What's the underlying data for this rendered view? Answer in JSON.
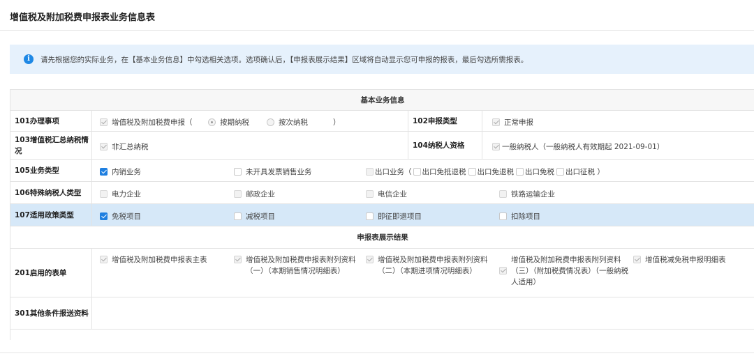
{
  "page_title": "增值税及附加税费申报表业务信息表",
  "notice": "请先根据您的实际业务，在【基本业务信息】中勾选相关选项。选项确认后，【申报表展示结果】区域将自动显示您可申报的报表，最后勾选所需报表。",
  "sections": {
    "basic": "基本业务信息",
    "result": "申报表展示结果"
  },
  "row101": {
    "label": "101办理事项",
    "option": "增值税及附加税费申报（",
    "radio1": "按期纳税",
    "radio2": "按次纳税",
    "close": "）",
    "label2": "102申报类型",
    "value2": "正常申报"
  },
  "row103": {
    "label": "103增值税汇总纳税情况",
    "option": "非汇总纳税",
    "label2": "104纳税人资格",
    "value2": "一般纳税人（一般纳税人有效期起 2021-09-01）"
  },
  "row105": {
    "label": "105业务类型",
    "o1": "内销业务",
    "o2": "未开具发票销售业务",
    "o3": "出口业务（",
    "o4": "出口免抵退税",
    "o5": "出口免退税",
    "o6": "出口免税",
    "o7": "出口征税 ）"
  },
  "row106": {
    "label": "106特殊纳税人类型",
    "o1": "电力企业",
    "o2": "邮政企业",
    "o3": "电信企业",
    "o4": "铁路运输企业"
  },
  "row107": {
    "label": "107适用政策类型",
    "o1": "免税项目",
    "o2": "减税项目",
    "o3": "即征即退项目",
    "o4": "扣除项目"
  },
  "row201": {
    "label": "201启用的表单",
    "f1": "增值税及附加税费申报表主表",
    "f2": "增值税及附加税费申报表附列资料（一）（本期销售情况明细表）",
    "f3": "增值税及附加税费申报表附列资料（二）（本期进项情况明细表）",
    "f4": "增值税及附加税费申报表附列资料（三）（附加税费情况表）（一般纳税人适用）",
    "f5": "增值税减免税申报明细表"
  },
  "row301": {
    "label": "301其他条件报送资料"
  },
  "colors": {
    "accent": "#1f7fe0",
    "highlight_row": "#d6e8f8",
    "notice_bg": "#e6f1fc"
  }
}
